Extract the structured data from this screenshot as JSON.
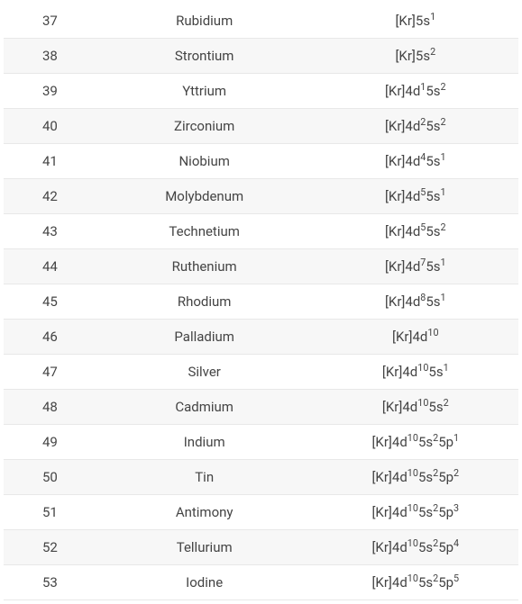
{
  "elements": [
    {
      "atomic_number": "37",
      "name": "Rubidium",
      "config_html": "[Kr]5s<sup>1</sup>"
    },
    {
      "atomic_number": "38",
      "name": "Strontium",
      "config_html": "[Kr]5s<sup>2</sup>"
    },
    {
      "atomic_number": "39",
      "name": "Yttrium",
      "config_html": "[Kr]4d<sup>1</sup>5s<sup>2</sup>"
    },
    {
      "atomic_number": "40",
      "name": "Zirconium",
      "config_html": "[Kr]4d<sup>2</sup>5s<sup>2</sup>"
    },
    {
      "atomic_number": "41",
      "name": "Niobium",
      "config_html": "[Kr]4d<sup>4</sup>5s<sup>1</sup>"
    },
    {
      "atomic_number": "42",
      "name": "Molybdenum",
      "config_html": "[Kr]4d<sup>5</sup>5s<sup>1</sup>"
    },
    {
      "atomic_number": "43",
      "name": "Technetium",
      "config_html": "[Kr]4d<sup>5</sup>5s<sup>2</sup>"
    },
    {
      "atomic_number": "44",
      "name": "Ruthenium",
      "config_html": "[Kr]4d<sup>7</sup>5s<sup>1</sup>"
    },
    {
      "atomic_number": "45",
      "name": "Rhodium",
      "config_html": "[Kr]4d<sup>8</sup>5s<sup>1</sup>"
    },
    {
      "atomic_number": "46",
      "name": "Palladium",
      "config_html": "[Kr]4d<sup>10</sup>"
    },
    {
      "atomic_number": "47",
      "name": "Silver",
      "config_html": "[Kr]4d<sup>10</sup>5s<sup>1</sup>"
    },
    {
      "atomic_number": "48",
      "name": "Cadmium",
      "config_html": "[Kr]4d<sup>10</sup>5s<sup>2</sup>"
    },
    {
      "atomic_number": "49",
      "name": "Indium",
      "config_html": "[Kr]4d<sup>10</sup>5s<sup>2</sup>5p<sup>1</sup>"
    },
    {
      "atomic_number": "50",
      "name": "Tin",
      "config_html": "[Kr]4d<sup>10</sup>5s<sup>2</sup>5p<sup>2</sup>"
    },
    {
      "atomic_number": "51",
      "name": "Antimony",
      "config_html": "[Kr]4d<sup>10</sup>5s<sup>2</sup>5p<sup>3</sup>"
    },
    {
      "atomic_number": "52",
      "name": "Tellurium",
      "config_html": "[Kr]4d<sup>10</sup>5s<sup>2</sup>5p<sup>4</sup>"
    },
    {
      "atomic_number": "53",
      "name": "Iodine",
      "config_html": "[Kr]4d<sup>10</sup>5s<sup>2</sup>5p<sup>5</sup>"
    }
  ]
}
